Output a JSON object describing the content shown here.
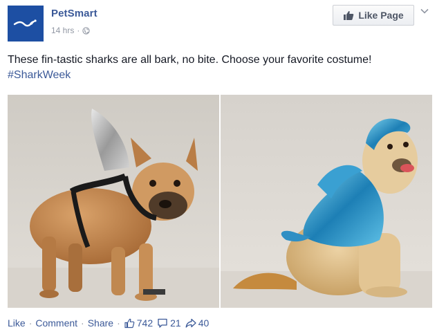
{
  "page": {
    "name": "PetSmart",
    "time": "14 hrs",
    "dot": "·"
  },
  "header": {
    "like_page_label": "Like Page"
  },
  "post": {
    "text": "These fin-tastic sharks are all bark, no bite. Choose your favorite costume!",
    "hashtag": "#SharkWeek"
  },
  "footer": {
    "like": "Like",
    "comment": "Comment",
    "share": "Share",
    "sep": "·",
    "likes_count": "742",
    "comments_count": "21",
    "shares_count": "40"
  },
  "colors": {
    "link": "#3b5998",
    "meta_gray": "#9197a3",
    "brand_blue": "#1d4fa3"
  },
  "icons": {
    "globe": "globe-icon",
    "thumb": "thumbs-up-icon",
    "comment": "comment-bubble-icon",
    "share": "share-arrow-icon",
    "chevron": "chevron-down-icon"
  }
}
